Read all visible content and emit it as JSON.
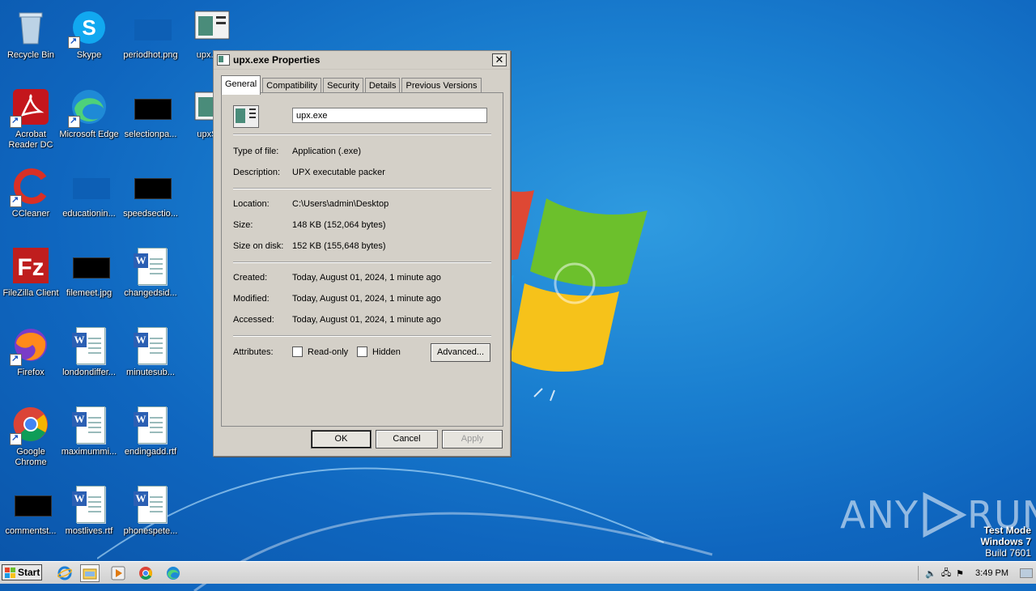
{
  "desktop": {
    "icons": [
      {
        "label": "Recycle Bin"
      },
      {
        "label": "Skype"
      },
      {
        "label": "periodhot.png"
      },
      {
        "label": "upx.exe"
      },
      {
        "label": "Acrobat Reader DC"
      },
      {
        "label": "Microsoft Edge"
      },
      {
        "label": "selectionpa..."
      },
      {
        "label": "upxSr..."
      },
      {
        "label": "CCleaner"
      },
      {
        "label": "educationin..."
      },
      {
        "label": "speedsectio..."
      },
      {
        "label": "FileZilla Client"
      },
      {
        "label": "filemeet.jpg"
      },
      {
        "label": "changedsid..."
      },
      {
        "label": "Firefox"
      },
      {
        "label": "londondiffer..."
      },
      {
        "label": "minutesub..."
      },
      {
        "label": "Google Chrome"
      },
      {
        "label": "maximummi..."
      },
      {
        "label": "endingadd.rtf"
      },
      {
        "label": "commentst..."
      },
      {
        "label": "mostlives.rtf"
      },
      {
        "label": "phonespete..."
      }
    ]
  },
  "dialog": {
    "title": "upx.exe Properties",
    "close_glyph": "✕",
    "tabs": [
      "General",
      "Compatibility",
      "Security",
      "Details",
      "Previous Versions"
    ],
    "filename": "upx.exe",
    "fields": {
      "type_label": "Type of file:",
      "type_value": "Application (.exe)",
      "desc_label": "Description:",
      "desc_value": "UPX executable packer",
      "loc_label": "Location:",
      "loc_value": "C:\\Users\\admin\\Desktop",
      "size_label": "Size:",
      "size_value": "148 KB (152,064 bytes)",
      "disk_label": "Size on disk:",
      "disk_value": "152 KB (155,648 bytes)",
      "created_label": "Created:",
      "created_value": "Today, August 01, 2024, 1 minute ago",
      "modified_label": "Modified:",
      "modified_value": "Today, August 01, 2024, 1 minute ago",
      "accessed_label": "Accessed:",
      "accessed_value": "Today, August 01, 2024, 1 minute ago",
      "attr_label": "Attributes:"
    },
    "readonly_label": "Read-only",
    "hidden_label": "Hidden",
    "advanced_label": "Advanced...",
    "ok_label": "OK",
    "cancel_label": "Cancel",
    "apply_label": "Apply"
  },
  "taskbar": {
    "start_label": "Start",
    "clock": "3:49 PM"
  },
  "watermark": {
    "text_left": "ANY",
    "text_right": "RUN",
    "mode_line1": "Test Mode",
    "mode_line2": "Windows 7",
    "mode_line3": "Build 7601"
  }
}
